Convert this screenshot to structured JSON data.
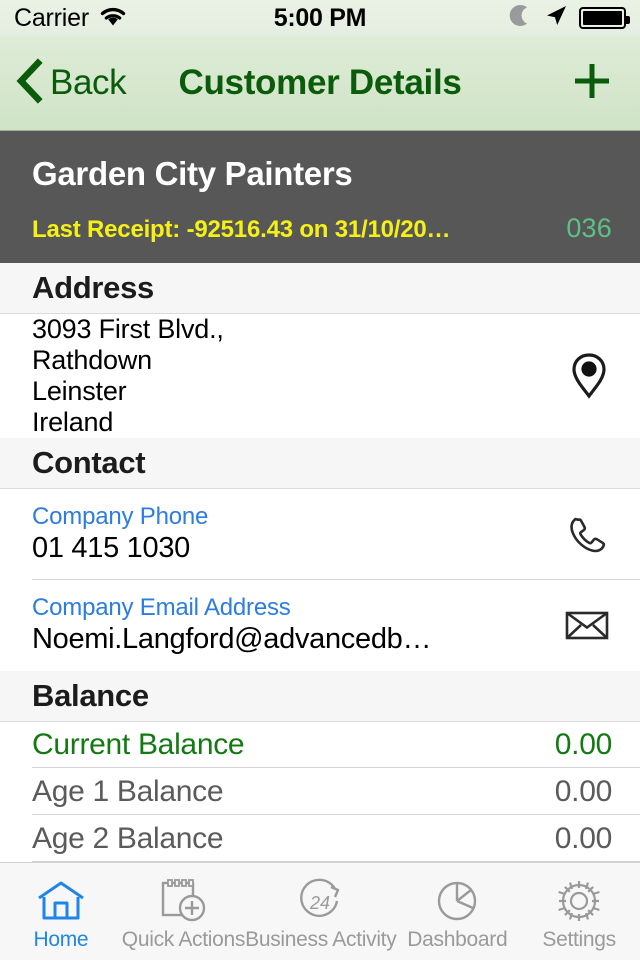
{
  "statusbar": {
    "carrier": "Carrier",
    "time": "5:00 PM",
    "wifi_icon": "wifi-icon",
    "moon_icon": "moon-icon",
    "location_icon": "location-arrow-icon",
    "battery_icon": "battery-full-icon"
  },
  "navbar": {
    "back_label": "Back",
    "back_icon": "chevron-left-icon",
    "title": "Customer Details",
    "add_icon": "plus-icon",
    "tint_color": "#0a5c0a"
  },
  "customer": {
    "name": "Garden City Painters",
    "last_receipt": "Last Receipt: -92516.43 on 31/10/20…",
    "code": "036",
    "background_color": "#575757",
    "receipt_color": "#f5f117",
    "code_color": "#5cc183"
  },
  "sections": {
    "address": {
      "header": "Address",
      "lines": [
        "3093 First Blvd.,",
        "Rathdown",
        "Leinster",
        "Ireland"
      ],
      "icon": "map-pin-icon"
    },
    "contact": {
      "header": "Contact",
      "fields": [
        {
          "label": "Company Phone",
          "value": "01 415 1030",
          "icon": "phone-icon"
        },
        {
          "label": "Company Email Address",
          "value": "Noemi.Langford@advancedb…",
          "icon": "envelope-icon"
        }
      ],
      "label_color": "#2c7ddf"
    },
    "balance": {
      "header": "Balance",
      "rows": [
        {
          "label": "Current Balance",
          "value": "0.00",
          "style": "current"
        },
        {
          "label": "Age 1 Balance",
          "value": "0.00",
          "style": "aged"
        },
        {
          "label": "Age 2 Balance",
          "value": "0.00",
          "style": "aged"
        }
      ],
      "current_color": "#137a13",
      "aged_color": "#5b5b5b"
    }
  },
  "tabbar": {
    "active_color": "#1e86e8",
    "inactive_color": "#9a9a9a",
    "tabs": [
      {
        "label": "Home",
        "icon": "home-icon",
        "active": true
      },
      {
        "label": "Quick Actions",
        "icon": "notepad-plus-icon",
        "active": false
      },
      {
        "label": "Business Activity",
        "icon": "24-hour-cycle-icon",
        "active": false
      },
      {
        "label": "Dashboard",
        "icon": "pie-chart-icon",
        "active": false
      },
      {
        "label": "Settings",
        "icon": "gear-icon",
        "active": false
      }
    ]
  }
}
